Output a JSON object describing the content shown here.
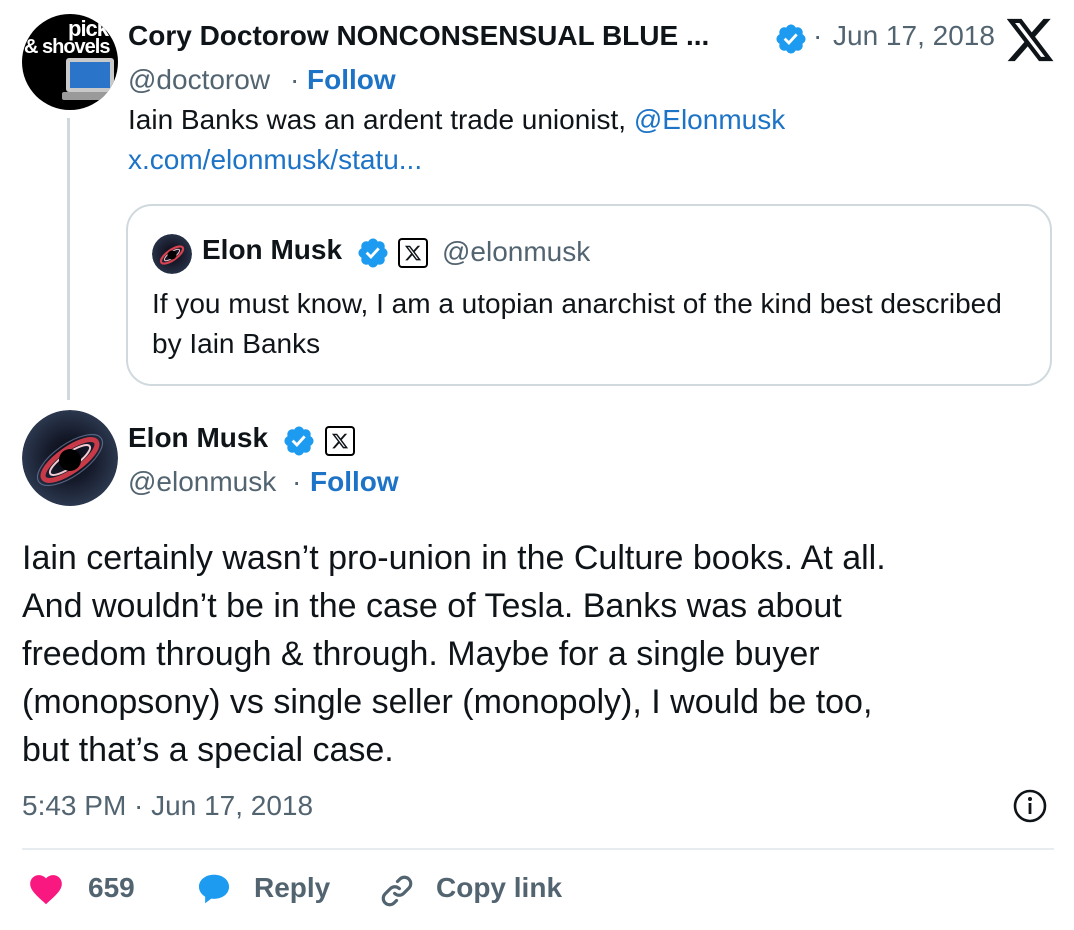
{
  "parent_tweet": {
    "avatar_text_top": "picks",
    "avatar_text_bottom": "& shovels",
    "display_name": "Cory Doctorow NONCONSENSUAL BLUE ...",
    "separator": "·",
    "date": "Jun 17, 2018",
    "handle": "@doctorow",
    "handle_separator": "·",
    "follow_label": "Follow",
    "text_prefix": "Iain Banks was an ardent trade unionist, ",
    "mention": "@Elonmusk",
    "link_text": "x.com/elonmusk/statu..."
  },
  "quoted_tweet": {
    "display_name": "Elon Musk",
    "handle": "@elonmusk",
    "text": "If you must know, I am a utopian anarchist of the kind best described by Iain Banks"
  },
  "main_tweet": {
    "display_name": "Elon Musk",
    "handle": "@elonmusk",
    "handle_separator": "·",
    "follow_label": "Follow",
    "text_lines": [
      "Iain certainly wasn’t pro-union in the Culture books. At all.",
      "And wouldn’t be in the case of Tesla. Banks was about",
      "freedom through & through. Maybe for a single buyer",
      "(monopsony) vs single seller (monopoly), I would be too,",
      "but that’s a special case."
    ],
    "timestamp": "5:43 PM · Jun 17, 2018"
  },
  "actions": {
    "like_count": "659",
    "reply_label": "Reply",
    "copy_link_label": "Copy link"
  },
  "colors": {
    "link_blue": "#1d73c6",
    "verified_blue": "#1d9bf0",
    "muted_gray": "#536471",
    "like_pink": "#f91880",
    "border_gray": "#cfd9de"
  },
  "icons": {
    "brand": "x-logo-icon",
    "verified": "verified-badge-icon",
    "affiliate": "x-affiliate-badge-icon",
    "info": "info-icon",
    "like": "heart-icon",
    "reply": "reply-bubble-icon",
    "copy_link": "link-icon"
  }
}
